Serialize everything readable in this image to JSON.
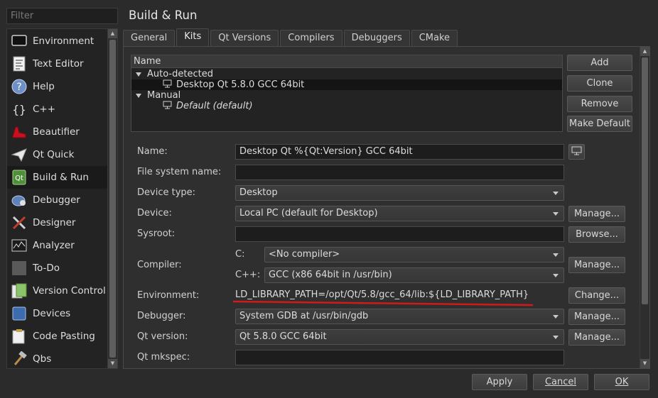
{
  "sidebar": {
    "filter_placeholder": "Filter",
    "items": [
      {
        "label": "Environment",
        "icon": "monitor-icon"
      },
      {
        "label": "Text Editor",
        "icon": "text-document-icon"
      },
      {
        "label": "Help",
        "icon": "help-icon"
      },
      {
        "label": "C++",
        "icon": "braces-icon"
      },
      {
        "label": "Beautifier",
        "icon": "shoe-icon"
      },
      {
        "label": "Qt Quick",
        "icon": "paper-plane-icon"
      },
      {
        "label": "Build & Run",
        "icon": "build-run-icon"
      },
      {
        "label": "Debugger",
        "icon": "bug-icon"
      },
      {
        "label": "Designer",
        "icon": "designer-tools-icon"
      },
      {
        "label": "Analyzer",
        "icon": "analyzer-chart-icon"
      },
      {
        "label": "To-Do",
        "icon": "todo-icon"
      },
      {
        "label": "Version Control",
        "icon": "version-control-icon"
      },
      {
        "label": "Devices",
        "icon": "devices-icon"
      },
      {
        "label": "Code Pasting",
        "icon": "code-pasting-icon"
      },
      {
        "label": "Qbs",
        "icon": "hammer-icon"
      }
    ],
    "selected": "Build & Run"
  },
  "page_title": "Build & Run",
  "tabs": [
    "General",
    "Kits",
    "Qt Versions",
    "Compilers",
    "Debuggers",
    "CMake"
  ],
  "active_tab": "Kits",
  "kit_tree": {
    "header": "Name",
    "groups": [
      {
        "label": "Auto-detected",
        "kits": [
          {
            "label": "Desktop Qt 5.8.0 GCC 64bit",
            "italic": false
          }
        ]
      },
      {
        "label": "Manual",
        "kits": [
          {
            "label": "Default (default)",
            "italic": true
          }
        ]
      }
    ]
  },
  "kit_buttons": {
    "add": "Add",
    "clone": "Clone",
    "remove": "Remove",
    "make_default": "Make Default"
  },
  "form": {
    "name_label": "Name:",
    "name_value": "Desktop Qt %{Qt:Version} GCC 64bit",
    "fsname_label": "File system name:",
    "fsname_value": "",
    "device_type_label": "Device type:",
    "device_type_value": "Desktop",
    "device_label": "Device:",
    "device_value": "Local PC (default for Desktop)",
    "device_manage": "Manage...",
    "sysroot_label": "Sysroot:",
    "sysroot_value": "",
    "sysroot_browse": "Browse...",
    "compiler_label": "Compiler:",
    "compiler_c_label": "C:",
    "compiler_c_value": "<No compiler>",
    "compiler_cpp_label": "C++:",
    "compiler_cpp_value": "GCC (x86 64bit in /usr/bin)",
    "compiler_manage": "Manage...",
    "env_label": "Environment:",
    "env_value": "LD_LIBRARY_PATH=/opt/Qt/5.8/gcc_64/lib:${LD_LIBRARY_PATH}",
    "env_change": "Change...",
    "debugger_label": "Debugger:",
    "debugger_value": "System GDB at /usr/bin/gdb",
    "debugger_manage": "Manage...",
    "qtversion_label": "Qt version:",
    "qtversion_value": "Qt 5.8.0 GCC 64bit",
    "qtversion_manage": "Manage...",
    "mkspec_label": "Qt mkspec:",
    "mkspec_value": ""
  },
  "dialog_buttons": {
    "apply": "Apply",
    "cancel": "Cancel",
    "ok": "OK"
  },
  "colors": {
    "background": "#2b2b2b",
    "annotation_underline": "#d21a1a"
  }
}
